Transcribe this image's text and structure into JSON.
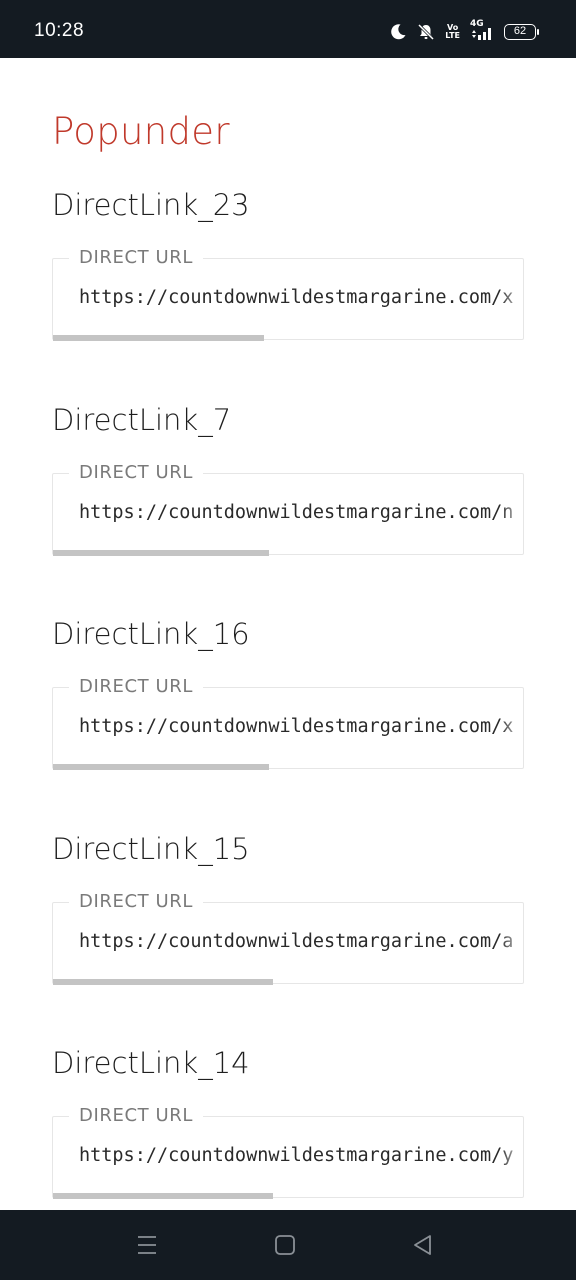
{
  "status_bar": {
    "time": "10:28",
    "icons": [
      "moon-icon",
      "bell-muted-icon",
      "volte-icon",
      "signal-4g-icon",
      "battery-icon"
    ],
    "volte_top": "Vo",
    "volte_bottom": "LTE",
    "network": "4G",
    "battery_level": "62"
  },
  "page": {
    "section_title": "Popunder",
    "field_label": "DIRECT URL",
    "links": [
      {
        "name": "DirectLink_23",
        "url": "https://countdownwildestmargarine.com/x",
        "scroll_fraction": 0.45
      },
      {
        "name": "DirectLink_7",
        "url": "https://countdownwildestmargarine.com/n",
        "scroll_fraction": 0.46
      },
      {
        "name": "DirectLink_16",
        "url": "https://countdownwildestmargarine.com/x",
        "scroll_fraction": 0.46
      },
      {
        "name": "DirectLink_15",
        "url": "https://countdownwildestmargarine.com/a",
        "scroll_fraction": 0.47
      },
      {
        "name": "DirectLink_14",
        "url": "https://countdownwildestmargarine.com/y",
        "scroll_fraction": 0.47
      }
    ]
  },
  "nav_bar": {
    "buttons": [
      "menu-icon",
      "home-icon",
      "back-icon"
    ]
  },
  "colors": {
    "status_bar_bg": "#141b22",
    "section_title": "#c0392b",
    "scrollbar": "#c4c4c4"
  }
}
